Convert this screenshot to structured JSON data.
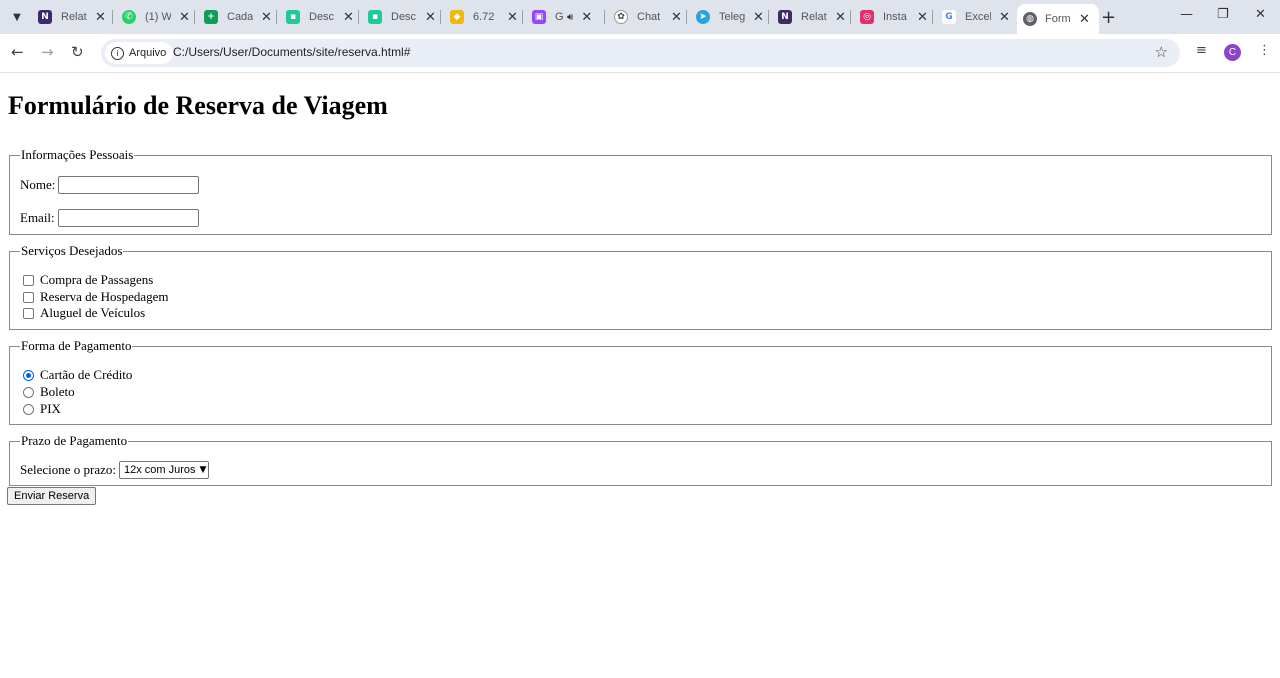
{
  "browser": {
    "tabs": [
      {
        "label": "Relat",
        "icon": "notion-icon",
        "color": "#3d2a6b",
        "glyph": "N"
      },
      {
        "label": "(1) W",
        "icon": "whatsapp-icon",
        "color": "#25d366",
        "glyph": "●"
      },
      {
        "label": "Cada",
        "icon": "sheets-icon",
        "color": "#0f9d58",
        "glyph": "+"
      },
      {
        "label": "Desc",
        "icon": "app-icon",
        "color": "#20c997",
        "glyph": "■"
      },
      {
        "label": "Desc",
        "icon": "app-icon",
        "color": "#20c997",
        "glyph": "■"
      },
      {
        "label": "6.72",
        "icon": "binance-icon",
        "color": "#f0b90b",
        "glyph": "◆"
      },
      {
        "label": "G",
        "icon": "twitch-icon",
        "color": "#9146ff",
        "glyph": "▣"
      },
      {
        "label": "Chat",
        "icon": "chatgpt-icon",
        "color": "#444444",
        "glyph": "✿"
      },
      {
        "label": "Teleg",
        "icon": "telegram-icon",
        "color": "#2aa3de",
        "glyph": "➤"
      },
      {
        "label": "Relat",
        "icon": "notion-icon",
        "color": "#3d2a6b",
        "glyph": "N"
      },
      {
        "label": "Insta",
        "icon": "instagram-icon",
        "color": "#e1306c",
        "glyph": "◎"
      },
      {
        "label": "Excel",
        "icon": "google-icon",
        "color": "#4285f4",
        "glyph": "G"
      },
      {
        "label": "Form",
        "icon": "globe-icon",
        "color": "#5f6368",
        "glyph": "◍"
      }
    ],
    "security_chip": "Arquivo",
    "url": "C:/Users/User/Documents/site/reserva.html#",
    "profile_initial": "C"
  },
  "page": {
    "title": "Formulário de Reserva de Viagem",
    "personal": {
      "legend": "Informações Pessoais",
      "name_label": "Nome:",
      "email_label": "Email:"
    },
    "services": {
      "legend": "Serviços Desejados",
      "options": [
        "Compra de Passagens",
        "Reserva de Hospedagem",
        "Aluguel de Veículos"
      ]
    },
    "payment": {
      "legend": "Forma de Pagamento",
      "options": [
        "Cartão de Crédito",
        "Boleto",
        "PIX"
      ],
      "selected": "Cartão de Crédito"
    },
    "term": {
      "legend": "Prazo de Pagamento",
      "select_label": "Selecione o prazo:",
      "selected_value": "12x com Juros"
    },
    "submit_label": "Enviar Reserva"
  }
}
